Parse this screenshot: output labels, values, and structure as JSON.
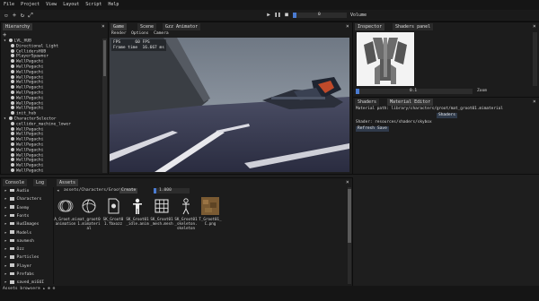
{
  "menu": [
    "File",
    "Project",
    "View",
    "Layout",
    "Script",
    "Help"
  ],
  "toolbar_left_icons": [
    "new-file-icon",
    "add-icon",
    "refresh-icon",
    "expand-icon"
  ],
  "play_controls": {
    "frame": "0"
  },
  "volume_label": "Volume",
  "hierarchy": {
    "tab": "Hierarchy",
    "items": [
      {
        "label": "LVL_HUB",
        "depth": 0
      },
      {
        "label": "Directional Light",
        "depth": 1
      },
      {
        "label": "CollidersHUB",
        "depth": 1
      },
      {
        "label": "PlayerSpawner",
        "depth": 1
      },
      {
        "label": "WallPagachi",
        "depth": 1
      },
      {
        "label": "WallPagachi",
        "depth": 1
      },
      {
        "label": "WallPagachi",
        "depth": 1
      },
      {
        "label": "WallPagachi",
        "depth": 1
      },
      {
        "label": "WallPagachi",
        "depth": 1
      },
      {
        "label": "WallPagachi",
        "depth": 1
      },
      {
        "label": "WallPagachi",
        "depth": 1
      },
      {
        "label": "WallPagachi",
        "depth": 1
      },
      {
        "label": "WallPagachi",
        "depth": 1
      },
      {
        "label": "WallPagachi",
        "depth": 1
      },
      {
        "label": "init_hub",
        "depth": 1
      },
      {
        "label": "CharacterSelector",
        "depth": 0
      },
      {
        "label": "collider_machine_lower",
        "depth": 1
      },
      {
        "label": "WallPagachi",
        "depth": 1
      },
      {
        "label": "WallPagachi",
        "depth": 1
      },
      {
        "label": "WallPagachi",
        "depth": 1
      },
      {
        "label": "WallPagachi",
        "depth": 1
      },
      {
        "label": "WallPagachi",
        "depth": 1
      },
      {
        "label": "WallPagachi",
        "depth": 1
      },
      {
        "label": "WallPagachi",
        "depth": 1
      },
      {
        "label": "WallPagachi",
        "depth": 1
      },
      {
        "label": "WallPagachi",
        "depth": 1
      }
    ]
  },
  "viewport": {
    "tabs": [
      "Game",
      "Scene",
      "Gzz Animator"
    ],
    "menu": [
      "Render",
      "Options",
      "Camera"
    ],
    "fps_label": "FPS",
    "fps_value": "60 FPS",
    "frame_label": "Frame time",
    "frame_value": "16.667 ms"
  },
  "inspector": {
    "tabs": [
      "Inspector",
      "Shaders panel"
    ],
    "slider_value": "0.1",
    "zoom_label": "Zoom",
    "sub_tabs": [
      "Shaders",
      "Material Editor"
    ],
    "material_path": "Material path: library/characters/groot/mat_groot01.mimaterial",
    "shaders_button": "Shaders",
    "shader_path": "Shader: resources/shaders/skybox",
    "refresh_button": "Refresh",
    "save_button": "Save"
  },
  "bottom": {
    "tabs": [
      "Console",
      "Log",
      "Assets"
    ],
    "path": "assets/Characters/Groot",
    "create_button": "Create",
    "zoom_value": "1.000",
    "folders": [
      "Audio",
      "Characters",
      "Enemy",
      "Fonts",
      "HudImages",
      "Models",
      "navmesh",
      "Ozz",
      "Particles",
      "Player",
      "Prefabs",
      "saved_miGUI"
    ],
    "assets": [
      {
        "name": "A_Groot.mianimation",
        "icon": "animation-icon"
      },
      {
        "name": "mat_groot01.mimaterial",
        "icon": "material-icon"
      },
      {
        "name": "SK_Groot01.fbxozz",
        "icon": "fbx-file-icon"
      },
      {
        "name": "SK_Groot01_idle.anim",
        "icon": "character-icon"
      },
      {
        "name": "SK_Groot01_mesh.mesh",
        "icon": "mesh-grid-icon"
      },
      {
        "name": "SK_Groot01_skeleton.skeleton",
        "icon": "skeleton-icon"
      },
      {
        "name": "T_Groot01_C.png",
        "icon": "texture-thumbnail"
      }
    ]
  },
  "statusbar": {
    "label": "Assets browser"
  }
}
